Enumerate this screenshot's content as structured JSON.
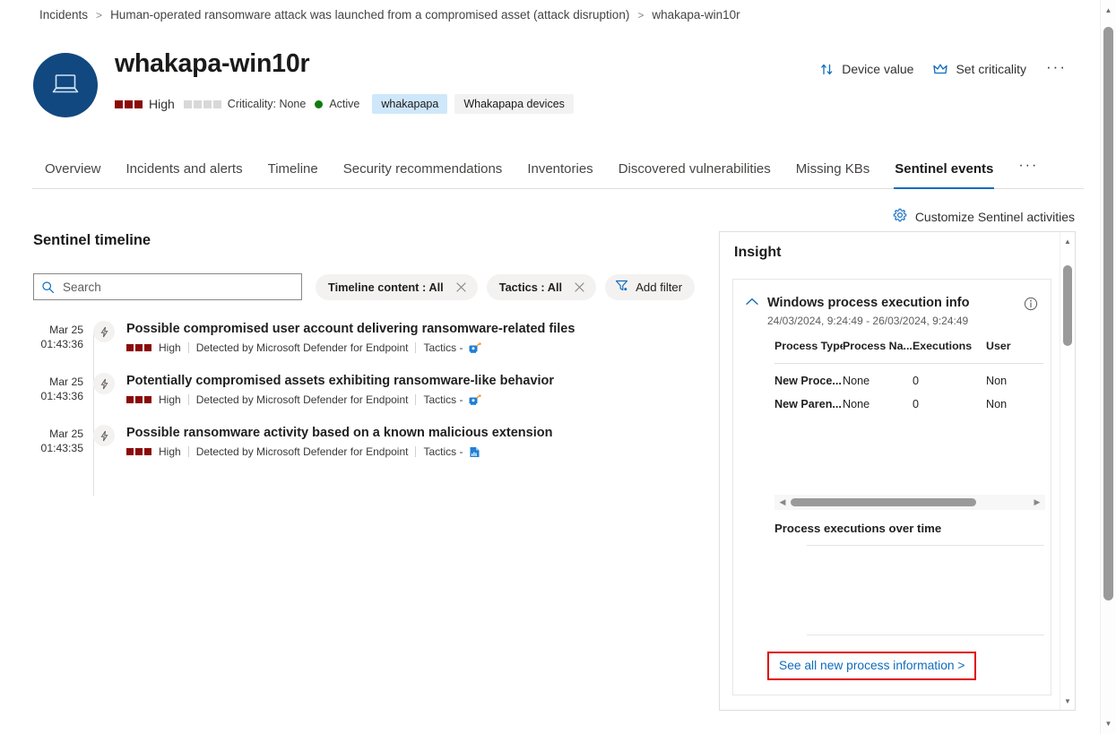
{
  "breadcrumb": {
    "items": [
      "Incidents",
      "Human-operated ransomware attack was launched from a compromised asset (attack disruption)",
      "whakapa-win10r"
    ],
    "separator": ">"
  },
  "header": {
    "title": "whakapa-win10r",
    "avatar_icon": "laptop-icon",
    "severity_label": "High",
    "severity_blocks_filled": 3,
    "criticality_label": "Criticality: None",
    "criticality_blocks": 4,
    "status_label": "Active",
    "status_color": "#107c10",
    "severity_color": "#8b0a0a",
    "tags": [
      {
        "label": "whakapapa",
        "style": "blue"
      },
      {
        "label": "Whakapapa devices",
        "style": "grey"
      }
    ],
    "commands": [
      {
        "label": "Device value",
        "icon": "sort-arrows-icon"
      },
      {
        "label": "Set criticality",
        "icon": "crown-icon"
      }
    ],
    "more_label": "···"
  },
  "tabs": {
    "items": [
      {
        "label": "Overview",
        "active": false
      },
      {
        "label": "Incidents and alerts",
        "active": false
      },
      {
        "label": "Timeline",
        "active": false
      },
      {
        "label": "Security recommendations",
        "active": false
      },
      {
        "label": "Inventories",
        "active": false
      },
      {
        "label": "Discovered vulnerabilities",
        "active": false
      },
      {
        "label": "Missing KBs",
        "active": false
      },
      {
        "label": "Sentinel events",
        "active": true
      }
    ],
    "more_label": "···",
    "accent_color": "#0f6cbd"
  },
  "toolbar": {
    "customize_label": "Customize Sentinel activities",
    "customize_icon": "gear-icon"
  },
  "timeline_panel": {
    "section_title": "Sentinel timeline",
    "search": {
      "placeholder": "Search",
      "value": "",
      "icon": "search-icon"
    },
    "filters": [
      {
        "label": "Timeline content : All",
        "closable": true
      },
      {
        "label": "Tactics : All",
        "closable": true
      }
    ],
    "add_filter": {
      "label": "Add filter",
      "icon": "filter-icon"
    },
    "events": [
      {
        "date": "Mar 25",
        "time": "01:43:36",
        "node_icon": "lightning-bolt-icon",
        "title": "Possible compromised user account delivering ransomware-related files",
        "severity": "High",
        "severity_blocks": 3,
        "detected_by": "Detected by Microsoft Defender for Endpoint",
        "tactics_label": "Tactics -",
        "tactics_icon": "credential-access-icon"
      },
      {
        "date": "Mar 25",
        "time": "01:43:36",
        "node_icon": "lightning-bolt-icon",
        "title": "Potentially compromised assets exhibiting ransomware-like behavior",
        "severity": "High",
        "severity_blocks": 3,
        "detected_by": "Detected by Microsoft Defender for Endpoint",
        "tactics_label": "Tactics -",
        "tactics_icon": "credential-access-icon"
      },
      {
        "date": "Mar 25",
        "time": "01:43:35",
        "node_icon": "lightning-bolt-icon",
        "title": "Possible ransomware activity based on a known malicious extension",
        "severity": "High",
        "severity_blocks": 3,
        "detected_by": "Detected by Microsoft Defender for Endpoint",
        "tactics_label": "Tactics -",
        "tactics_icon": "impact-icon"
      }
    ]
  },
  "insight_panel": {
    "title": "Insight",
    "card": {
      "chevron_icon": "chevron-up-icon",
      "heading": "Windows process execution info",
      "date_range": "24/03/2024, 9:24:49 - 26/03/2024, 9:24:49",
      "info_icon": "info-icon",
      "table": {
        "headers": [
          "Process Type",
          "Process Na...",
          "Executions",
          "User"
        ],
        "rows": [
          [
            "New Proce...",
            "None",
            "0",
            "Non"
          ],
          [
            "New Paren...",
            "None",
            "0",
            "Non"
          ]
        ]
      },
      "hscroll": {
        "left_arrow": "◀",
        "right_arrow": "▶"
      },
      "chart_title": "Process executions over time",
      "link": {
        "label": "See all new process information >",
        "highlight_color": "#e00b0b"
      }
    }
  },
  "chart_data": {
    "type": "line",
    "title": "Process executions over time",
    "x": [],
    "values": [],
    "series": [],
    "xlabel": "",
    "ylabel": "",
    "grid": true,
    "note": "Empty plot area – no data series rendered; only two faint horizontal gridlines visible"
  },
  "scrollbars": {
    "page": {
      "up_arrow": "▲",
      "down_arrow": "▼"
    },
    "insight": {
      "up_arrow": "▲",
      "down_arrow": "▼"
    }
  }
}
